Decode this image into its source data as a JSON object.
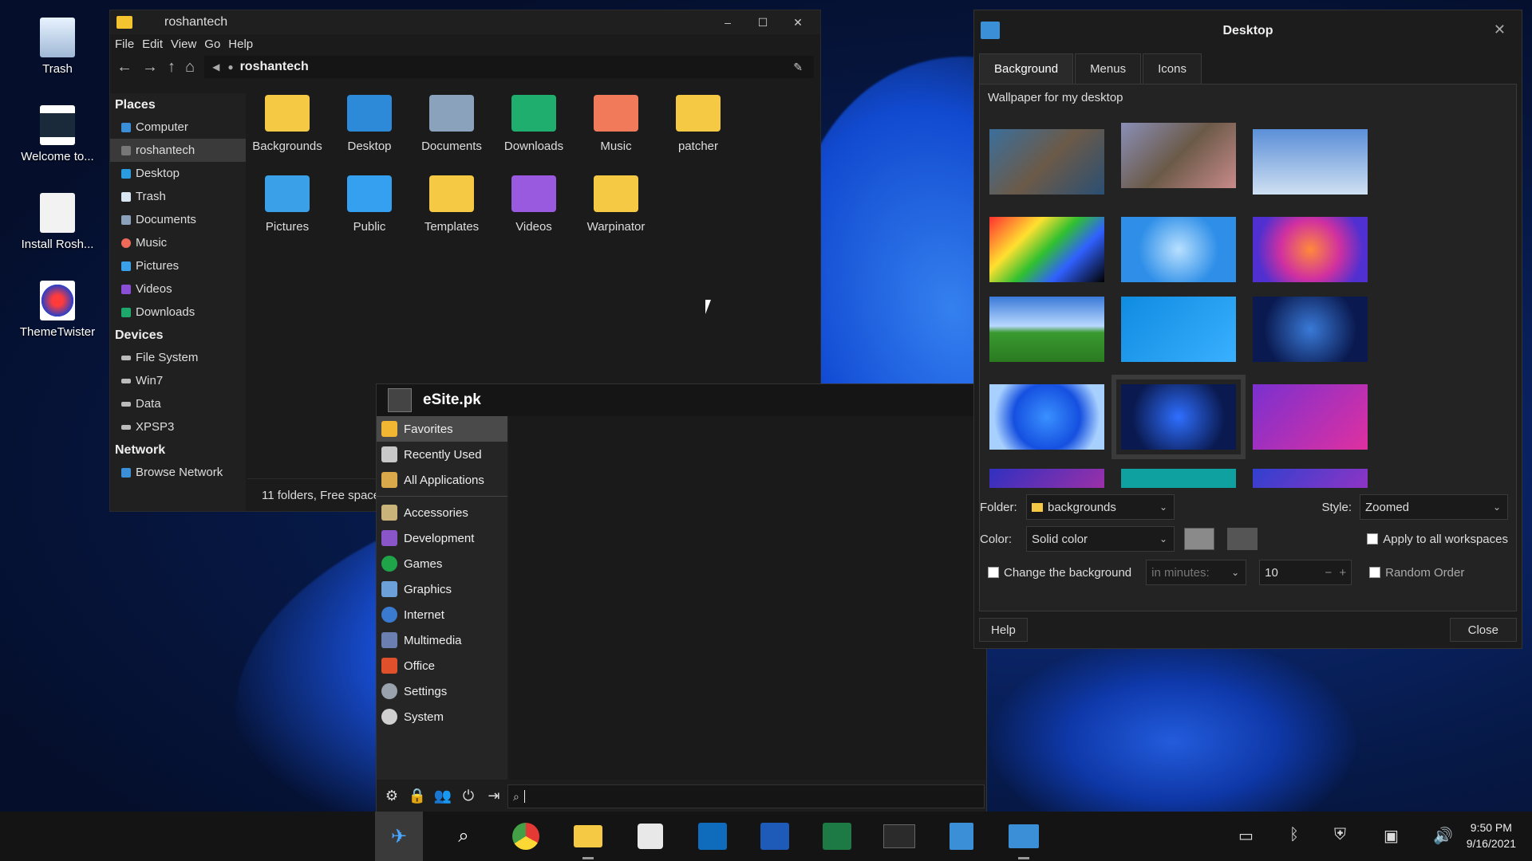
{
  "desktop_icons": [
    {
      "label": "Trash",
      "icon": "trash-icon"
    },
    {
      "label": "Welcome to...",
      "icon": "welcome-icon"
    },
    {
      "label": "Install Rosh...",
      "icon": "document-icon"
    },
    {
      "label": "ThemeTwister",
      "icon": "themetwister-icon"
    }
  ],
  "file_manager": {
    "title": "roshantech",
    "window_buttons": [
      "–",
      "☐",
      "✕"
    ],
    "menu": [
      "File",
      "Edit",
      "View",
      "Go",
      "Help"
    ],
    "path": "roshantech",
    "sidebar": {
      "places_header": "Places",
      "places": [
        "Computer",
        "roshantech",
        "Desktop",
        "Trash",
        "Documents",
        "Music",
        "Pictures",
        "Videos",
        "Downloads"
      ],
      "devices_header": "Devices",
      "devices": [
        "File System",
        "Win7",
        "Data",
        "XPSP3"
      ],
      "network_header": "Network",
      "network": [
        "Browse Network"
      ]
    },
    "folders": [
      "Backgrounds",
      "Desktop",
      "Documents",
      "Downloads",
      "Music",
      "patcher",
      "Pictures",
      "Public",
      "Templates",
      "Videos",
      "Warpinator"
    ],
    "status": "11 folders, Free space:"
  },
  "menu": {
    "username": "eSite.pk",
    "categories": [
      "Favorites",
      "Recently Used",
      "All Applications",
      "Accessories",
      "Development",
      "Games",
      "Graphics",
      "Internet",
      "Multimedia",
      "Office",
      "Settings",
      "System"
    ],
    "search_placeholder": ""
  },
  "desktop_settings": {
    "title": "Desktop",
    "tabs": [
      "Background",
      "Menus",
      "Icons"
    ],
    "caption": "Wallpaper for my desktop",
    "folder_label": "Folder:",
    "folder_value": "backgrounds",
    "style_label": "Style:",
    "style_value": "Zoomed",
    "color_label": "Color:",
    "color_value": "Solid color",
    "apply_all": "Apply to all workspaces",
    "change_bg": "Change the background",
    "interval_unit": "in minutes:",
    "interval_value": "10",
    "random_order": "Random Order",
    "help": "Help",
    "close": "Close"
  },
  "clock": {
    "time": "9:50 PM",
    "date": "9/16/2021"
  }
}
